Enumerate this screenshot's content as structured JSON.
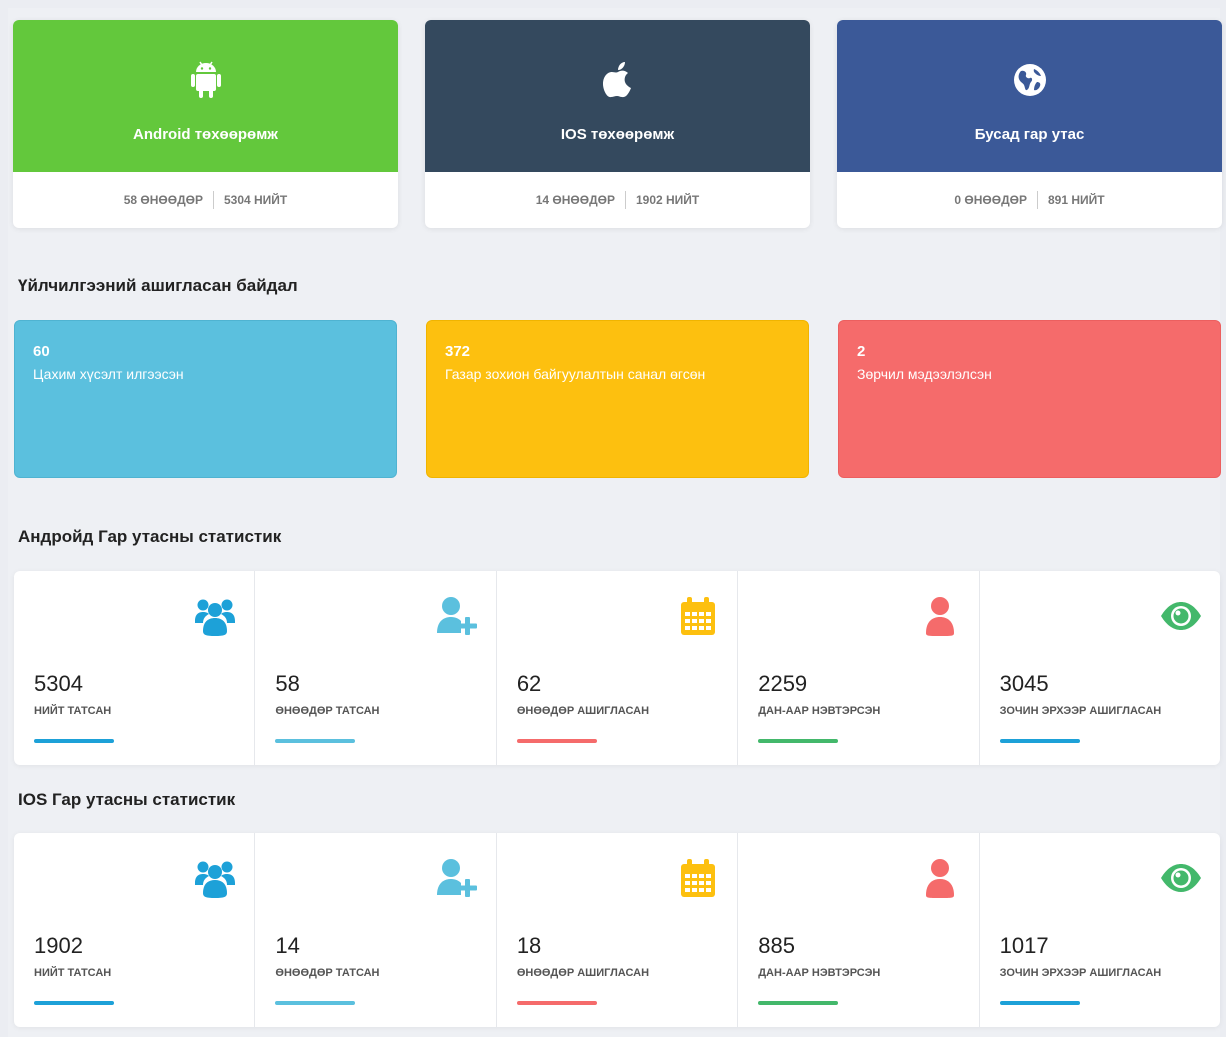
{
  "devices": [
    {
      "label": "Android төхөөрөмж",
      "today": "58 ӨНӨӨДӨР",
      "total": "5304 НИЙТ",
      "color": "#63c83c",
      "icon": "android-icon"
    },
    {
      "label": "IOS төхөөрөмж",
      "today": "14 ӨНӨӨДӨР",
      "total": "1902 НИЙТ",
      "color": "#34495e",
      "icon": "apple-icon"
    },
    {
      "label": "Бусад гар утас",
      "today": "0 ӨНӨӨДӨР",
      "total": "891 НИЙТ",
      "color": "#3b5998",
      "icon": "globe-icon"
    }
  ],
  "usage_title": "Үйлчилгээний ашигласан байдал",
  "usage": [
    {
      "value": "60",
      "text": "Цахим хүсэлт илгээсэн",
      "color": "#5bc0de"
    },
    {
      "value": "372",
      "text": "Газар зохион байгуулалтын санал өгсөн",
      "color": "#fdc00f"
    },
    {
      "value": "2",
      "text": "Зөрчил мэдээлэлсэн",
      "color": "#f56b6b"
    }
  ],
  "android_title": "Андройд Гар утасны статистик",
  "ios_title": "IOS Гар утасны статистик",
  "android_stats": [
    {
      "value": "5304",
      "label": "НИЙТ ТАТСАН"
    },
    {
      "value": "58",
      "label": "ӨНӨӨДӨР ТАТСАН"
    },
    {
      "value": "62",
      "label": "ӨНӨӨДӨР АШИГЛАСАН"
    },
    {
      "value": "2259",
      "label": "ДАН-ААР НЭВТЭРСЭН"
    },
    {
      "value": "3045",
      "label": "ЗОЧИН ЭРХЭЭР АШИГЛАСАН"
    }
  ],
  "ios_stats": [
    {
      "value": "1902",
      "label": "НИЙТ ТАТСАН"
    },
    {
      "value": "14",
      "label": "ӨНӨӨДӨР ТАТСАН"
    },
    {
      "value": "18",
      "label": "ӨНӨӨДӨР АШИГЛАСАН"
    },
    {
      "value": "885",
      "label": "ДАН-ААР НЭВТЭРСЭН"
    },
    {
      "value": "1017",
      "label": "ЗОЧИН ЭРХЭЭР АШИГЛАСАН"
    }
  ],
  "stat_icons": [
    "users-icon",
    "user-plus-icon",
    "calendar-icon",
    "user-icon",
    "eye-icon"
  ],
  "stat_colors": {
    "blue": "#1da1d8",
    "light_blue": "#5bc0de",
    "yellow": "#fdc00f",
    "red": "#f56b6b",
    "green": "#43b86b"
  }
}
